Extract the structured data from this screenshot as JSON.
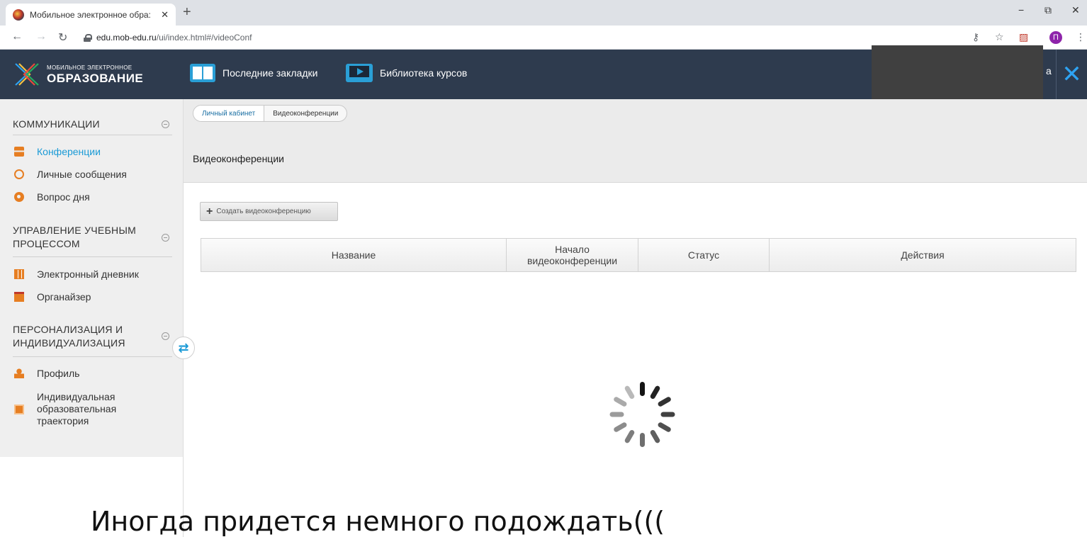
{
  "browser": {
    "tab_title": "Мобильное электронное обра:",
    "tab_close": "✕",
    "new_tab": "+",
    "url_host": "edu.mob-edu.ru",
    "url_path": "/ui/index.html#/videoConf",
    "profile_letter": "П",
    "window_controls": {
      "minimize": "−",
      "restore": "⧉",
      "close": "✕"
    }
  },
  "header": {
    "logo_small": "МОБИЛЬНОЕ ЭЛЕКТРОННОЕ",
    "logo_big": "ОБРАЗОВАНИЕ",
    "nav_bookmarks": "Последние закладки",
    "nav_library": "Библиотека курсов",
    "user_partial": "а",
    "close_glyph": "✕"
  },
  "sidebar": {
    "sections": [
      {
        "title": "КОММУНИКАЦИИ",
        "items": [
          "Конференции",
          "Личные сообщения",
          "Вопрос дня"
        ]
      },
      {
        "title": "УПРАВЛЕНИЕ УЧЕБНЫМ ПРОЦЕССОМ",
        "items": [
          "Электронный дневник",
          "Органайзер"
        ]
      },
      {
        "title": "ПЕРСОНАЛИЗАЦИЯ И ИНДИВИДУАЛИЗАЦИЯ",
        "items": [
          "Профиль",
          "Индивидуальная образовательная траектория"
        ]
      }
    ],
    "active_item": "Конференции",
    "collapse_glyph": "⇄"
  },
  "breadcrumb": [
    "Личный кабинет",
    "Видеоконференции"
  ],
  "page_title": "Видеоконференции",
  "create_button": "Создать видеоконференцию",
  "table": {
    "columns": [
      "Название",
      "Начало видеоконференции",
      "Статус",
      "Действия"
    ]
  },
  "caption": "Иногда придется немного подождать(((",
  "colors": {
    "header_bg": "#2e3b4e",
    "accent": "#1a9ad6",
    "icon_orange": "#e67e22",
    "sidebar_bg": "#efefef"
  }
}
